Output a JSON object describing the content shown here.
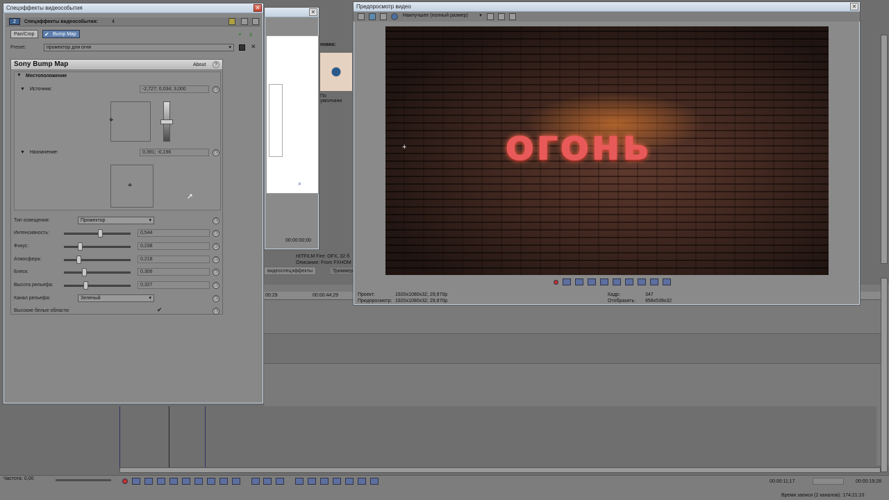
{
  "fx_window": {
    "title": "Спецэффекты видеособытия",
    "header_label": "Спецэффекты видеособытия:",
    "header_count": "4",
    "chain_tabs": [
      "Pan/Crop",
      "Bump Map"
    ],
    "preset_label": "Preset:",
    "preset_value": "прожектор для огня",
    "plugin_name": "Sony Bump Map",
    "about_label": "About",
    "help_label": "?",
    "section_location": "Местоположение",
    "source_label": "Источник:",
    "source_value": "-2,727; 0,034; 3,000",
    "dest_label": "Назначение:",
    "dest_value": "0,391; -0,196",
    "light_type_label": "Тип освещения:",
    "light_type_value": "Прожектор",
    "params": [
      {
        "label": "Интенсивность:",
        "value": "0,544",
        "level": 0.544
      },
      {
        "label": "Фокус:",
        "value": "0,238",
        "level": 0.238
      },
      {
        "label": "Атмосфера:",
        "value": "0,218",
        "level": 0.218
      },
      {
        "label": "Блеск:",
        "value": "0,306",
        "level": 0.306
      },
      {
        "label": "Высота рельефа:",
        "value": "0,327",
        "level": 0.327
      }
    ],
    "channel_label": "Канал рельефа:",
    "channel_value": "Зеленый",
    "highlight_label": "Высокие белые области:"
  },
  "bg_window": {
    "fragment_text": "новка:",
    "default_label": "По умолчани",
    "timecode": "00:00:00;00",
    "media_info_1": "HITFILM Fire: OFX, 32 б",
    "media_info_2": "Описание: From FXHOM",
    "tab_fx": "видеоспецэффекты",
    "tab_trimmer": "Триммер"
  },
  "preview": {
    "title": "Предпросмотр видео",
    "quality": "Наилучшее (полный размер)",
    "overlay_text": "огонь",
    "project_label": "Проект:",
    "project_value": "1920x1080x32; 29,970p",
    "preview_label": "Предпросмотр:",
    "preview_value": "1920x1080x32; 29,970p",
    "frame_label": "Кадр:",
    "frame_value": "347",
    "display_label": "Отобразить:",
    "display_value": "958x539x32"
  },
  "timeline": {
    "ruler_left": "00:29",
    "ruler_mid": "00:00:44;29",
    "rate_label": "Частота: 0,00",
    "current_time": "00:00:11;17",
    "end_time": "00:00:19;28",
    "record_time": "Время записи (2 каналов): 174:21:10"
  },
  "colors": {
    "accent": "#5c6fa0",
    "titlebar": "#c3d1e0",
    "record": "#c03030"
  }
}
